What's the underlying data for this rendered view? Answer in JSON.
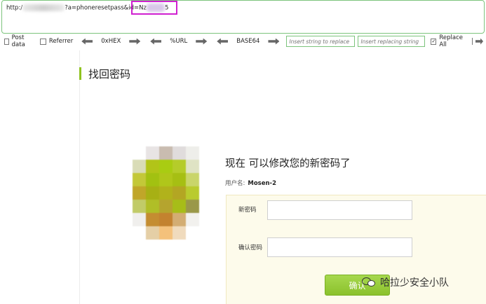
{
  "url_bar": {
    "prefix": "http:/",
    "middle": "?a=phoneresetpass&id=Nz",
    "suffix": "5"
  },
  "toolbar": {
    "post_data_label": "Post data",
    "referrer_label": "Referrer",
    "hex_label": "0xHEX",
    "url_label": "%URL",
    "base64_label": "BASE64",
    "insert_placeholder": "Insert string to replace",
    "replacing_placeholder": "Insert replacing string",
    "replace_all_label": "Replace All",
    "replace_all_checked": true
  },
  "page": {
    "section_title": "找回密码",
    "headline": "现在 可以修改您的新密码了",
    "username_label": "用户名:",
    "username_value": "Mosen-2",
    "new_password_label": "新密码",
    "confirm_password_label": "确认密码",
    "submit_label": "确认"
  },
  "watermark": {
    "text": "哈拉少安全小队"
  },
  "colors": {
    "accent_green": "#8fc31f",
    "form_bg": "#fdfbeb",
    "highlight_box": "#d020d0"
  }
}
